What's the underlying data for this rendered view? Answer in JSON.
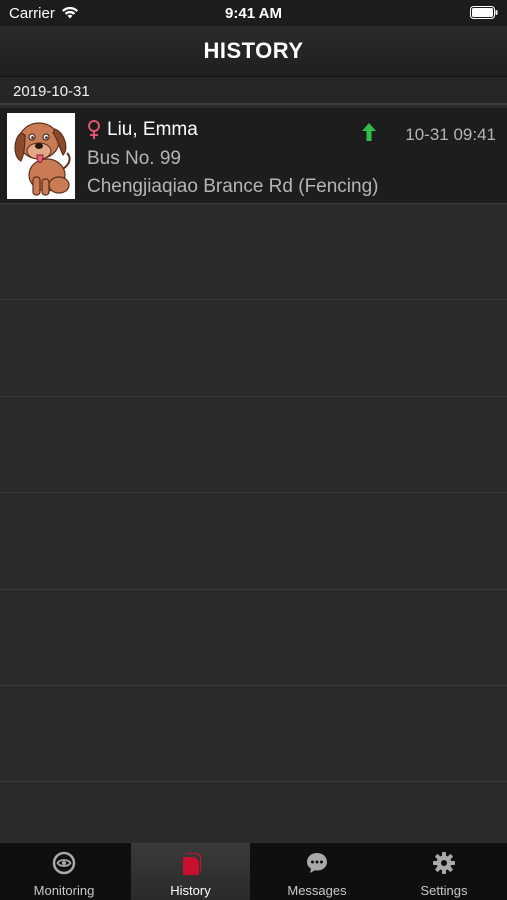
{
  "status_bar": {
    "carrier": "Carrier",
    "time": "9:41 AM",
    "icons": [
      "wifi-icon",
      "battery-icon"
    ]
  },
  "nav": {
    "title": "HISTORY"
  },
  "section": {
    "date": "2019-10-31"
  },
  "records": [
    {
      "name": "Liu, Emma",
      "gender_icon": "female-icon",
      "bus": "Bus No. 99",
      "location": "Chengjiaqiao Brance Rd (Fencing)",
      "direction_icon": "arrow-up-icon",
      "time": "10-31 09:41"
    }
  ],
  "tabs": [
    {
      "label": "Monitoring",
      "icon": "monitoring-icon",
      "selected": false
    },
    {
      "label": "History",
      "icon": "history-icon",
      "selected": true
    },
    {
      "label": "Messages",
      "icon": "messages-icon",
      "selected": false
    },
    {
      "label": "Settings",
      "icon": "gear-icon",
      "selected": false
    }
  ],
  "colors": {
    "background": "#2a2a2a",
    "row_background": "#1d1d1d",
    "female": "#e0566f",
    "arrow_up": "#2fbf4a",
    "history_tab_icon": "#c8102e",
    "tab_icon": "#a9a9a9"
  }
}
